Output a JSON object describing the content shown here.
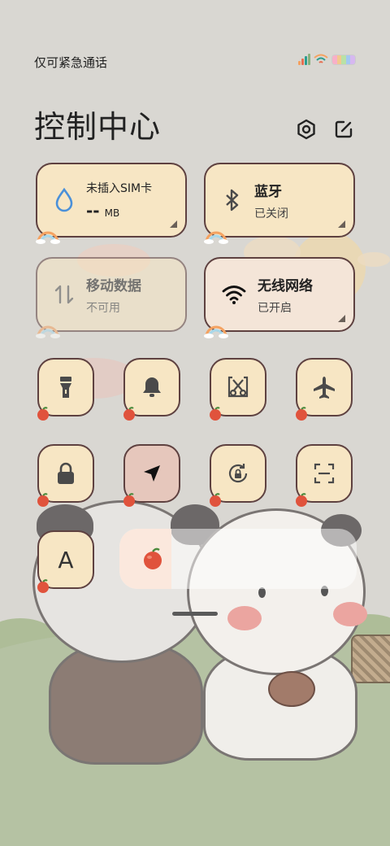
{
  "status_bar": {
    "carrier_text": "仅可紧急通话",
    "signal_colors": [
      "#f4a261",
      "#e76f51",
      "#2a9d8f",
      "#8ab17d"
    ],
    "battery_colors": [
      "#f7b0c8",
      "#f2c88f",
      "#b9e1a6",
      "#a4c8f0",
      "#d6b8f0"
    ]
  },
  "header": {
    "title": "控制中心",
    "settings_icon": "hexagon-gear-icon",
    "edit_icon": "edit-icon"
  },
  "tiles": {
    "data_usage": {
      "title": "未插入SIM卡",
      "value": "--",
      "unit": "MB",
      "icon": "water-drop-icon",
      "icon_color": "#4a90d9"
    },
    "bluetooth": {
      "title": "蓝牙",
      "status": "已关闭",
      "icon": "bluetooth-icon"
    },
    "mobile_data": {
      "title": "移动数据",
      "status": "不可用",
      "icon": "data-arrows-icon"
    },
    "wifi": {
      "title": "无线网络",
      "status": "已开启",
      "icon": "wifi-icon"
    }
  },
  "toggles": [
    {
      "name": "flashlight",
      "icon": "flashlight-icon",
      "active": false
    },
    {
      "name": "sound",
      "icon": "bell-icon",
      "active": false
    },
    {
      "name": "screenshot",
      "icon": "scissors-icon",
      "active": false
    },
    {
      "name": "airplane",
      "icon": "airplane-icon",
      "active": false
    },
    {
      "name": "lock",
      "icon": "lock-icon",
      "active": false
    },
    {
      "name": "location",
      "icon": "location-arrow-icon",
      "active": true
    },
    {
      "name": "rotation-lock",
      "icon": "rotate-lock-icon",
      "active": false
    },
    {
      "name": "scanner",
      "icon": "scan-icon",
      "active": false
    },
    {
      "name": "font-size",
      "icon": "letter-a-icon",
      "label": "A",
      "active": false
    }
  ],
  "brightness": {
    "level": 0.22,
    "icon": "apple-icon"
  },
  "colors": {
    "tile_bg": "#f7e6c4",
    "tile_border": "#5e4140",
    "active_toggle": "#e6c7bc"
  }
}
